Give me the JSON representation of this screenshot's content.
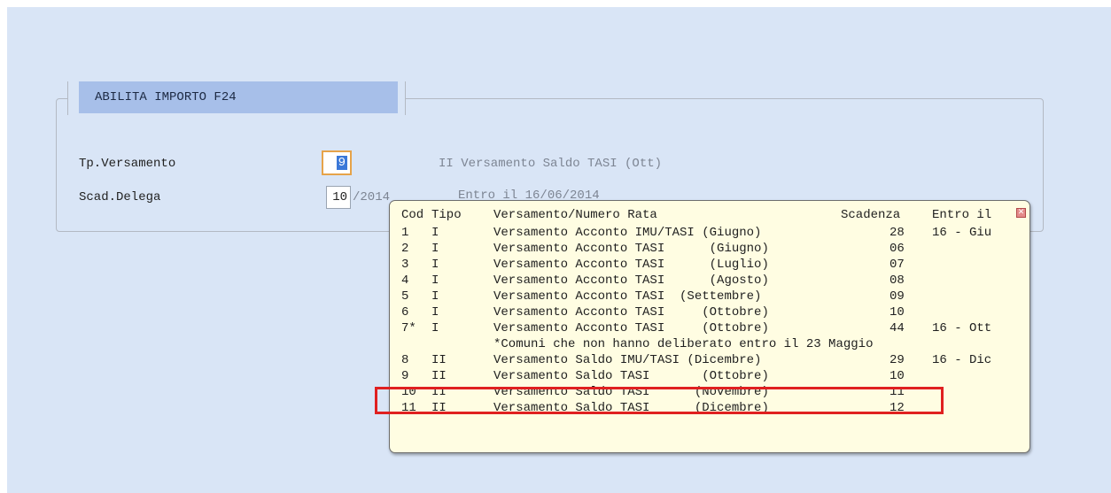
{
  "form": {
    "section_title": "ABILITA IMPORTO F24",
    "tp_versamento_label": "Tp.Versamento",
    "tp_versamento_value": "9",
    "tp_versamento_desc": "II Versamento Saldo TASI (Ott)",
    "scad_delega_label": "Scad.Delega",
    "scad_delega_value": "10",
    "scad_delega_year": "/2014",
    "entro_il": "Entro il   16/06/2014"
  },
  "popup": {
    "headers": [
      "Cod",
      "Tipo",
      "Versamento/Numero Rata",
      "Scadenza",
      "Entro il"
    ],
    "rows": [
      {
        "cod": "1",
        "tipo": "I",
        "desc": "Versamento Acconto IMU/TASI (Giugno)",
        "scad": "28",
        "entro": "16 - Giu"
      },
      {
        "cod": "2",
        "tipo": "I",
        "desc": "Versamento Acconto TASI      (Giugno)",
        "scad": "06",
        "entro": ""
      },
      {
        "cod": "3",
        "tipo": "I",
        "desc": "Versamento Acconto TASI      (Luglio)",
        "scad": "07",
        "entro": ""
      },
      {
        "cod": "4",
        "tipo": "I",
        "desc": "Versamento Acconto TASI      (Agosto)",
        "scad": "08",
        "entro": ""
      },
      {
        "cod": "5",
        "tipo": "I",
        "desc": "Versamento Acconto TASI  (Settembre)",
        "scad": "09",
        "entro": ""
      },
      {
        "cod": "6",
        "tipo": "I",
        "desc": "Versamento Acconto TASI     (Ottobre)",
        "scad": "10",
        "entro": ""
      },
      {
        "cod": "7*",
        "tipo": "I",
        "desc": "Versamento Acconto TASI     (Ottobre)",
        "scad": "44",
        "entro": "16 - Ott"
      },
      {
        "cod": "",
        "tipo": "",
        "desc": "*Comuni che non hanno deliberato entro il 23 Maggio",
        "scad": "",
        "entro": ""
      },
      {
        "cod": "8",
        "tipo": "II",
        "desc": "Versamento Saldo IMU/TASI (Dicembre)",
        "scad": "29",
        "entro": "16 - Dic"
      },
      {
        "cod": "9",
        "tipo": "II",
        "desc": "Versamento Saldo TASI       (Ottobre)",
        "scad": "10",
        "entro": ""
      },
      {
        "cod": "10",
        "tipo": "II",
        "desc": "Versamento Saldo TASI      (Novembre)",
        "scad": "11",
        "entro": ""
      },
      {
        "cod": "11",
        "tipo": "II",
        "desc": "Versamento Saldo TASI      (Dicembre)",
        "scad": "12",
        "entro": ""
      }
    ],
    "close_icon": "close-icon"
  },
  "colors": {
    "background": "#d9e5f6",
    "title_bar": "#a7bfe9",
    "popup_bg": "#fffde2",
    "highlight": "#e02020",
    "focus": "#e6a34a"
  }
}
